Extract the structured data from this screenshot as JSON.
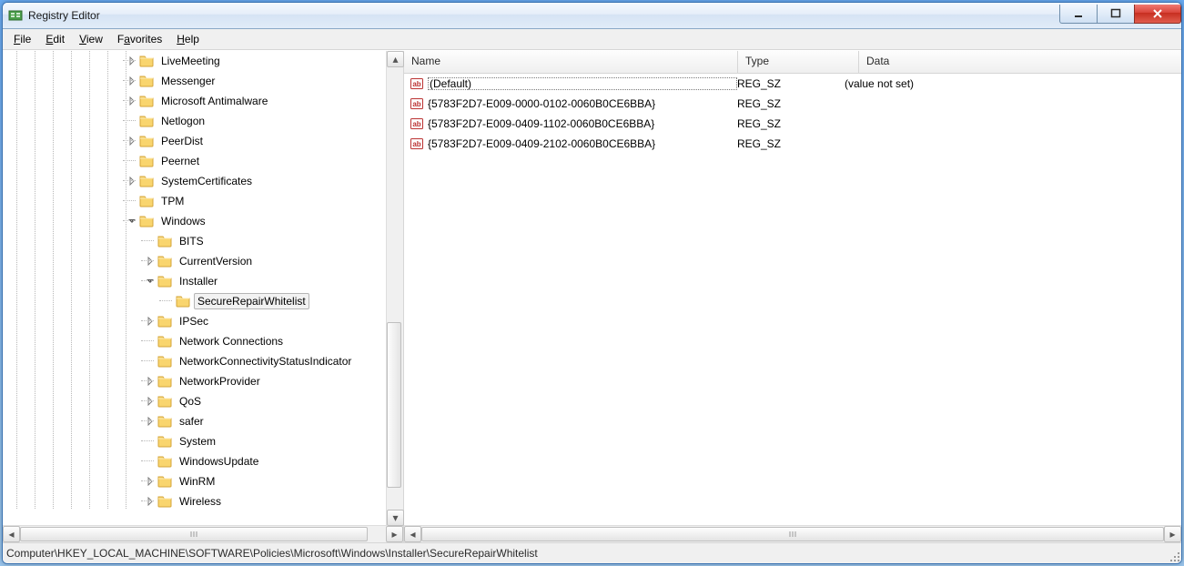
{
  "window": {
    "title": "Registry Editor"
  },
  "menu": {
    "file": "File",
    "edit": "Edit",
    "view": "View",
    "favorites": "Favorites",
    "help": "Help"
  },
  "tree": {
    "items": [
      {
        "indent": 7,
        "expander": "closed",
        "label": "LiveMeeting"
      },
      {
        "indent": 7,
        "expander": "closed",
        "label": "Messenger"
      },
      {
        "indent": 7,
        "expander": "closed",
        "label": "Microsoft Antimalware"
      },
      {
        "indent": 7,
        "expander": "none",
        "label": "Netlogon"
      },
      {
        "indent": 7,
        "expander": "closed",
        "label": "PeerDist"
      },
      {
        "indent": 7,
        "expander": "none",
        "label": "Peernet"
      },
      {
        "indent": 7,
        "expander": "closed",
        "label": "SystemCertificates"
      },
      {
        "indent": 7,
        "expander": "none",
        "label": "TPM"
      },
      {
        "indent": 7,
        "expander": "open",
        "label": "Windows"
      },
      {
        "indent": 8,
        "expander": "none",
        "label": "BITS"
      },
      {
        "indent": 8,
        "expander": "closed",
        "label": "CurrentVersion"
      },
      {
        "indent": 8,
        "expander": "open",
        "label": "Installer"
      },
      {
        "indent": 9,
        "expander": "none",
        "label": "SecureRepairWhitelist",
        "selected": true
      },
      {
        "indent": 8,
        "expander": "closed",
        "label": "IPSec"
      },
      {
        "indent": 8,
        "expander": "none",
        "label": "Network Connections"
      },
      {
        "indent": 8,
        "expander": "none",
        "label": "NetworkConnectivityStatusIndicator"
      },
      {
        "indent": 8,
        "expander": "closed",
        "label": "NetworkProvider"
      },
      {
        "indent": 8,
        "expander": "closed",
        "label": "QoS"
      },
      {
        "indent": 8,
        "expander": "closed",
        "label": "safer"
      },
      {
        "indent": 8,
        "expander": "none",
        "label": "System"
      },
      {
        "indent": 8,
        "expander": "none",
        "label": "WindowsUpdate"
      },
      {
        "indent": 8,
        "expander": "closed",
        "label": "WinRM"
      },
      {
        "indent": 8,
        "expander": "closed",
        "label": "Wireless"
      }
    ]
  },
  "list": {
    "columns": {
      "name": "Name",
      "type": "Type",
      "data": "Data"
    },
    "rows": [
      {
        "name": "(Default)",
        "type": "REG_SZ",
        "data": "(value not set)",
        "default": true
      },
      {
        "name": "{5783F2D7-E009-0000-0102-0060B0CE6BBA}",
        "type": "REG_SZ",
        "data": ""
      },
      {
        "name": "{5783F2D7-E009-0409-1102-0060B0CE6BBA}",
        "type": "REG_SZ",
        "data": ""
      },
      {
        "name": "{5783F2D7-E009-0409-2102-0060B0CE6BBA}",
        "type": "REG_SZ",
        "data": ""
      }
    ]
  },
  "status": {
    "path": "Computer\\HKEY_LOCAL_MACHINE\\SOFTWARE\\Policies\\Microsoft\\Windows\\Installer\\SecureRepairWhitelist"
  }
}
